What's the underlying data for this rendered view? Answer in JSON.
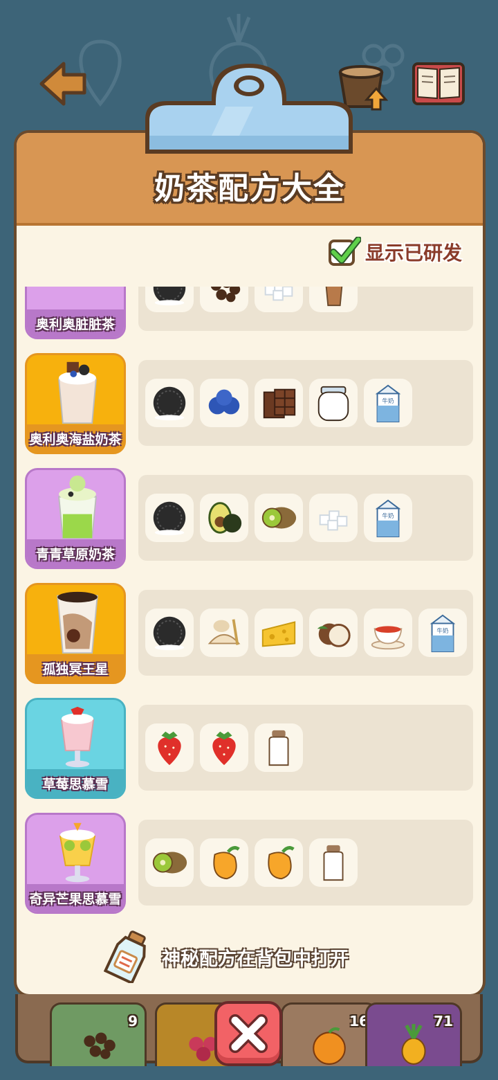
{
  "header": {
    "title": "奶茶配方大全",
    "toggle_label": "显示已研发",
    "toggle_checked": true
  },
  "recipes": [
    {
      "name": "奥利奥脏脏茶",
      "card_color": "#dca0ea",
      "border": "#b878c9",
      "ingredients": [
        "oreo",
        "tapioca",
        "sugar-cubes",
        "coffee-cup"
      ]
    },
    {
      "name": "奥利奥海盐奶茶",
      "card_color": "#f7b10d",
      "border": "#e59620",
      "ingredients": [
        "oreo",
        "blueberry",
        "chocolate",
        "cream-jar",
        "milk-carton"
      ]
    },
    {
      "name": "青青草原奶茶",
      "card_color": "#dca0ea",
      "border": "#b878c9",
      "ingredients": [
        "oreo",
        "avocado",
        "kiwi",
        "sugar-cubes",
        "milk-carton"
      ]
    },
    {
      "name": "孤独冥王星",
      "card_color": "#f7b10d",
      "border": "#e59620",
      "ingredients": [
        "oreo",
        "oats",
        "cheese",
        "coconut",
        "tea-cup",
        "milk-carton"
      ]
    },
    {
      "name": "草莓思慕雪",
      "card_color": "#6ad4e2",
      "border": "#49b2c2",
      "ingredients": [
        "strawberry",
        "strawberry",
        "milk-bottle"
      ]
    },
    {
      "name": "奇异芒果思慕雪",
      "card_color": "#dca0ea",
      "border": "#b878c9",
      "ingredients": [
        "kiwi",
        "mango",
        "mango",
        "milk-bottle"
      ]
    }
  ],
  "hint": "神秘配方在背包中打开",
  "tray": {
    "slots": [
      {
        "item": "tapioca",
        "count": "9",
        "color": "#6f9a63"
      },
      {
        "item": "grapes",
        "count": "",
        "color": "#b88728"
      },
      {
        "item": "orange",
        "count": "16",
        "color": "#9b7a60"
      },
      {
        "item": "pineapple",
        "count": "71",
        "color": "#7a4b8f"
      }
    ]
  },
  "colors": {
    "background": "#3d6478",
    "header": "#d89653",
    "panel": "#fbf4e4",
    "close": "#f26266"
  }
}
